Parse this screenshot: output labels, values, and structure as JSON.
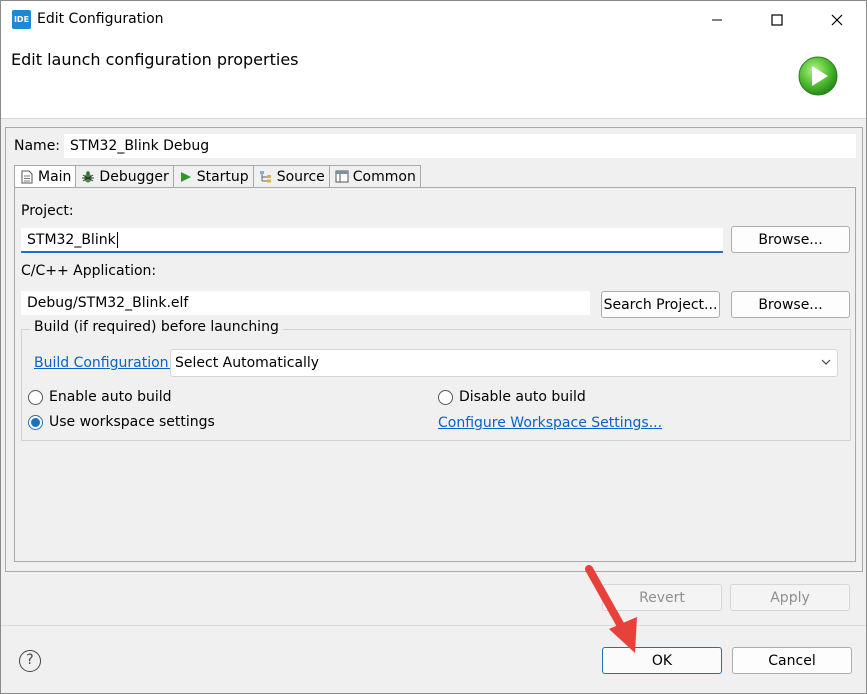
{
  "window": {
    "title": "Edit Configuration",
    "icon_text": "IDE"
  },
  "header": {
    "title": "Edit launch configuration properties"
  },
  "name": {
    "label": "Name:",
    "value": "STM32_Blink Debug"
  },
  "tabs": [
    {
      "label": "Main",
      "icon": "document-icon"
    },
    {
      "label": "Debugger",
      "icon": "bug-icon"
    },
    {
      "label": "Startup",
      "icon": "play-icon"
    },
    {
      "label": "Source",
      "icon": "source-tree-icon"
    },
    {
      "label": "Common",
      "icon": "window-icon"
    }
  ],
  "main": {
    "project_label": "Project:",
    "project_value": "STM32_Blink",
    "browse_label": "Browse...",
    "app_label": "C/C++ Application:",
    "app_value": "Debug/STM32_Blink.elf",
    "search_project_label": "Search Project...",
    "browse2_label": "Browse...",
    "build_group_title": "Build (if required) before launching",
    "build_config_link": "Build Configuration:",
    "build_config_value": "Select Automatically",
    "enable_auto_build": "Enable auto build",
    "disable_auto_build": "Disable auto build",
    "use_workspace_settings": "Use workspace settings",
    "configure_workspace_link": "Configure Workspace Settings...",
    "selected_build_option": "use_workspace_settings"
  },
  "actions": {
    "revert_label": "Revert",
    "apply_label": "Apply",
    "ok_label": "OK",
    "cancel_label": "Cancel",
    "help_glyph": "?"
  },
  "colors": {
    "accent": "#1f6fbf",
    "link": "#0b63c5",
    "annotation_arrow": "#e8413a"
  }
}
